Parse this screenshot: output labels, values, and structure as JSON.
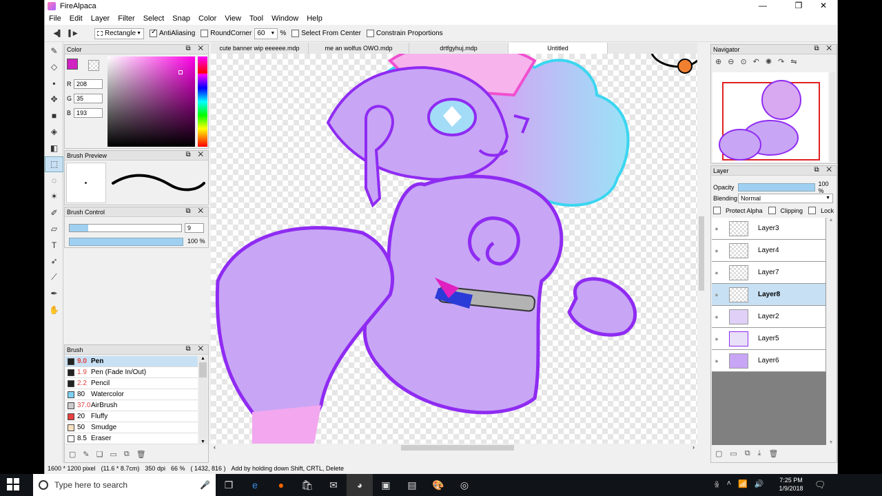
{
  "app": {
    "title": "FireAlpaca"
  },
  "window_buttons": [
    "—",
    "❐",
    "✕"
  ],
  "menu": [
    "File",
    "Edit",
    "Layer",
    "Filter",
    "Select",
    "Snap",
    "Color",
    "View",
    "Tool",
    "Window",
    "Help"
  ],
  "toolbar": {
    "shape": "Rectangle",
    "antialiasing_label": "AntiAliasing",
    "antialiasing_checked": true,
    "roundcorner_label": "RoundCorner",
    "roundcorner_value": "60",
    "roundcorner_unit": "%",
    "select_from_center_label": "Select From Center",
    "constrain_label": "Constrain Proportions"
  },
  "color_panel": {
    "title": "Color",
    "r_label": "R",
    "r": "208",
    "g_label": "G",
    "g": "35",
    "b_label": "B",
    "b": "193",
    "primary": "#d023c1",
    "secondary": "#2b3bd8"
  },
  "brush_preview": {
    "title": "Brush Preview"
  },
  "brush_control": {
    "title": "Brush Control",
    "size": "9",
    "opacity": "100 %"
  },
  "brush_panel": {
    "title": "Brush",
    "items": [
      {
        "size": "9.0",
        "name": "Pen",
        "color": "#222222",
        "active": true
      },
      {
        "size": "1.9",
        "name": "Pen (Fade In/Out)",
        "color": "#222222"
      },
      {
        "size": "2.2",
        "name": "Pencil",
        "color": "#222222"
      },
      {
        "size": "80",
        "name": "Watercolor",
        "color": "#7fd0f0"
      },
      {
        "size": "37.0",
        "name": "AirBrush",
        "color": "#cccccc"
      },
      {
        "size": "20",
        "name": "Fluffy",
        "color": "#e84040"
      },
      {
        "size": "50",
        "name": "Smudge",
        "color": "#f8e0c0"
      },
      {
        "size": "8.5",
        "name": "Eraser",
        "color": "#ffffff"
      }
    ]
  },
  "tabs": [
    {
      "label": "cute banner wip eeeeee.mdp"
    },
    {
      "label": "me an wolfus OWO.mdp"
    },
    {
      "label": "drtfgyhuj.mdp"
    },
    {
      "label": "Untitled",
      "active": true
    }
  ],
  "navigator": {
    "title": "Navigator"
  },
  "layer_panel": {
    "title": "Layer",
    "opacity_label": "Opacity",
    "opacity_value": "100 %",
    "opacity_fraction": 1.0,
    "blending_label": "Blending",
    "blending_value": "Normal",
    "protect_alpha": "Protect Alpha",
    "clipping": "Clipping",
    "lock": "Lock",
    "layers": [
      {
        "name": "Layer3"
      },
      {
        "name": "Layer4"
      },
      {
        "name": "Layer7"
      },
      {
        "name": "Layer8",
        "active": true
      },
      {
        "name": "Layer2"
      },
      {
        "name": "Layer5"
      },
      {
        "name": "Layer6"
      }
    ]
  },
  "status": {
    "size": "1600 * 1200 pixel",
    "physical": "(11.6 * 8.7cm)",
    "dpi": "350 dpi",
    "zoom": "66 %",
    "coords": "( 1432, 816 )",
    "hint": "Add by holding down Shift, CRTL, Delete"
  },
  "taskbar": {
    "search_placeholder": "Type here to search",
    "time": "7:25 PM",
    "date": "1/9/2018"
  }
}
